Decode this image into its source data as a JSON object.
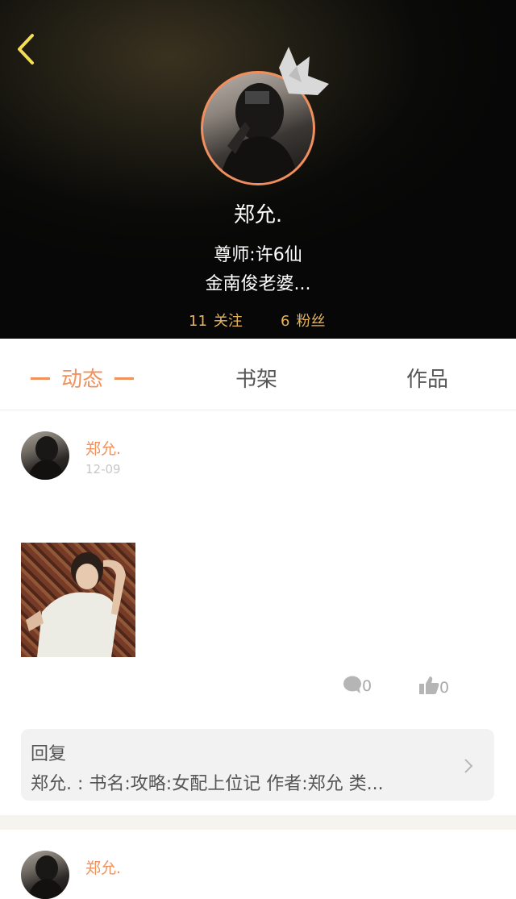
{
  "header": {
    "username": "郑允.",
    "bio_line1": "尊师:许6仙",
    "bio_line2": "金南俊老婆...",
    "following_count": "11",
    "following_label": "关注",
    "fans_count": "6",
    "fans_label": "粉丝"
  },
  "tabs": [
    {
      "label": "动态",
      "active": true
    },
    {
      "label": "书架",
      "active": false
    },
    {
      "label": "作品",
      "active": false
    }
  ],
  "posts": [
    {
      "author": "郑允.",
      "date": "12-09",
      "comments": "0",
      "likes": "0",
      "reply_label": "回复",
      "reply_text": "郑允. : 书名:攻略:女配上位记 作者:郑允 类..."
    },
    {
      "author": "郑允."
    }
  ],
  "colors": {
    "accent": "#f0925e",
    "gold": "#e8b45a",
    "back_icon": "#f2dd55"
  },
  "icons": [
    "back-icon",
    "crown-icon",
    "comment-icon",
    "thumbs-up-icon",
    "chevron-right-icon"
  ]
}
